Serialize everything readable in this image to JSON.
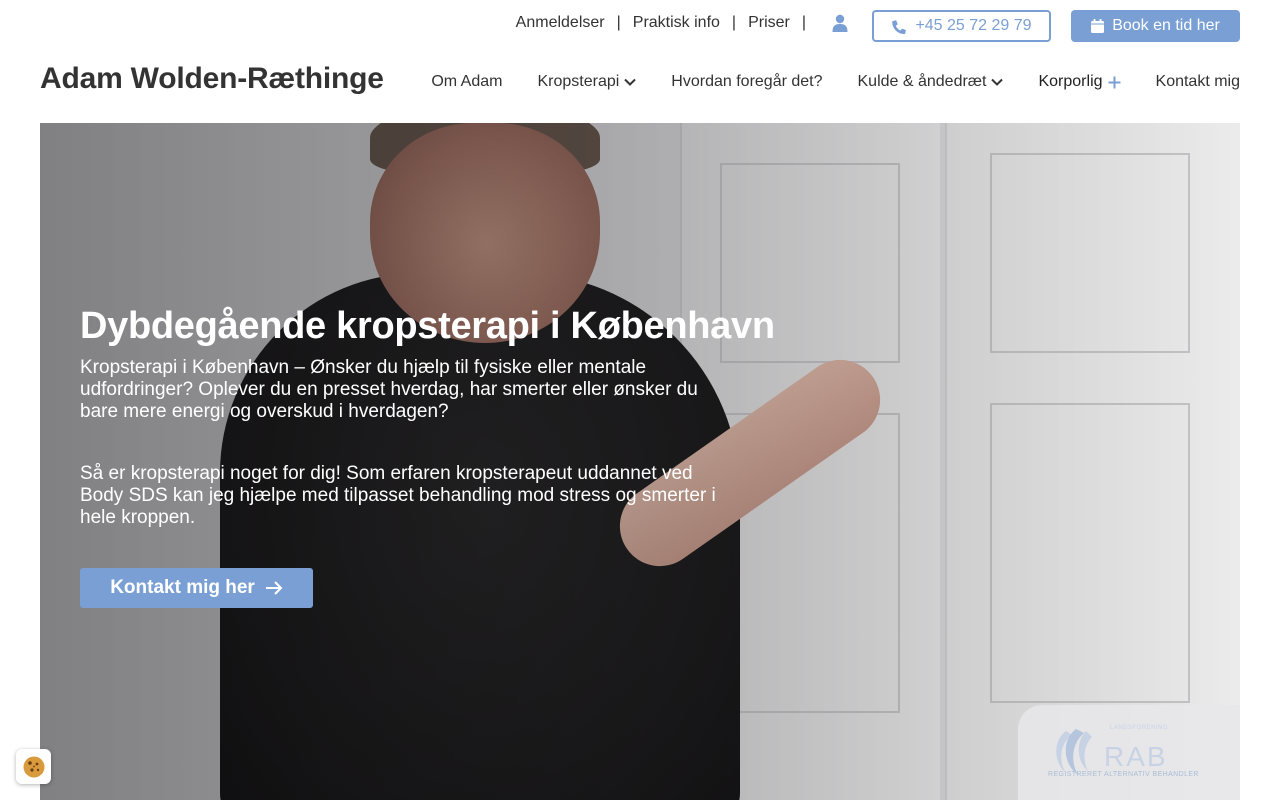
{
  "topbar": {
    "links": [
      "Anmeldelser",
      "Praktisk info",
      "Priser"
    ],
    "phone_label": "+45 25 72 29 79",
    "book_label": "Book en tid her"
  },
  "header": {
    "logo": "Adam Wolden-Ræthinge",
    "nav": [
      {
        "label": "Om Adam",
        "dropdown": false
      },
      {
        "label": "Kropsterapi",
        "dropdown": true
      },
      {
        "label": "Hvordan foregår det?",
        "dropdown": false
      },
      {
        "label": "Kulde & åndedræt",
        "dropdown": true
      },
      {
        "label": "Korporlig",
        "dropdown": "plus"
      },
      {
        "label": "Kontakt mig",
        "dropdown": false
      }
    ]
  },
  "hero": {
    "title": "Dybdegående kropsterapi i København",
    "paragraph1": "Kropsterapi i København – Ønsker du hjælp til fysiske eller mentale udfordringer? Oplever du en presset hverdag, har smerter eller ønsker du bare mere energi og overskud i hverdagen?",
    "paragraph2": "Så er kropsterapi noget for dig! Som erfaren kropsterapeut uddannet ved Body SDS kan jeg hjælpe med tilpasset behandling mod stress og smerter i hele kroppen.",
    "cta_label": "Kontakt mig her"
  },
  "badge": {
    "title": "RAB",
    "small": "LANDSFORENING",
    "subtitle": "REGISTRERET ALTERNATIV BEHANDLER"
  },
  "colors": {
    "accent": "#7a9fd4",
    "text": "#333333",
    "white": "#ffffff"
  },
  "icons": {
    "user": "user-icon",
    "phone": "phone-icon",
    "calendar": "calendar-icon",
    "arrow": "arrow-right-icon",
    "chevron": "chevron-down-icon",
    "plus": "plus-icon",
    "cookie": "cookie-icon"
  }
}
